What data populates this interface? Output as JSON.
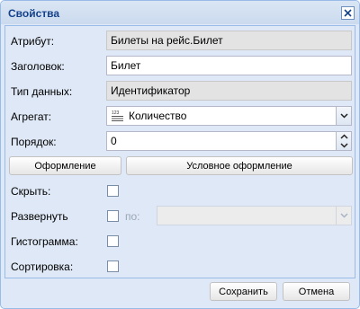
{
  "dialog": {
    "title": "Свойства",
    "close_icon": "close-icon"
  },
  "fields": {
    "attribute": {
      "label": "Атрибут:",
      "value": "Билеты на рейс.Билет"
    },
    "header": {
      "label": "Заголовок:",
      "value": "Билет"
    },
    "data_type": {
      "label": "Тип данных:",
      "value": "Идентификатор"
    },
    "aggregate": {
      "label": "Агрегат:",
      "value": "Количество",
      "icon": "numeric-list-icon"
    },
    "order": {
      "label": "Порядок:",
      "value": "0"
    }
  },
  "buttons": {
    "design": "Оформление",
    "conditional_design": "Условное оформление",
    "save": "Сохранить",
    "cancel": "Отмена"
  },
  "checks": {
    "hide": {
      "label": "Скрыть:",
      "checked": false
    },
    "expand": {
      "label": "Развернуть",
      "checked": false,
      "by_label": "по:",
      "by_value": ""
    },
    "histogram": {
      "label": "Гистограмма:",
      "checked": false
    },
    "sort": {
      "label": "Сортировка:",
      "checked": false
    }
  },
  "colors": {
    "panel": "#dfe8f6",
    "border": "#99bbe8",
    "title": "#15428b",
    "readonly": "#e3e3e3"
  }
}
